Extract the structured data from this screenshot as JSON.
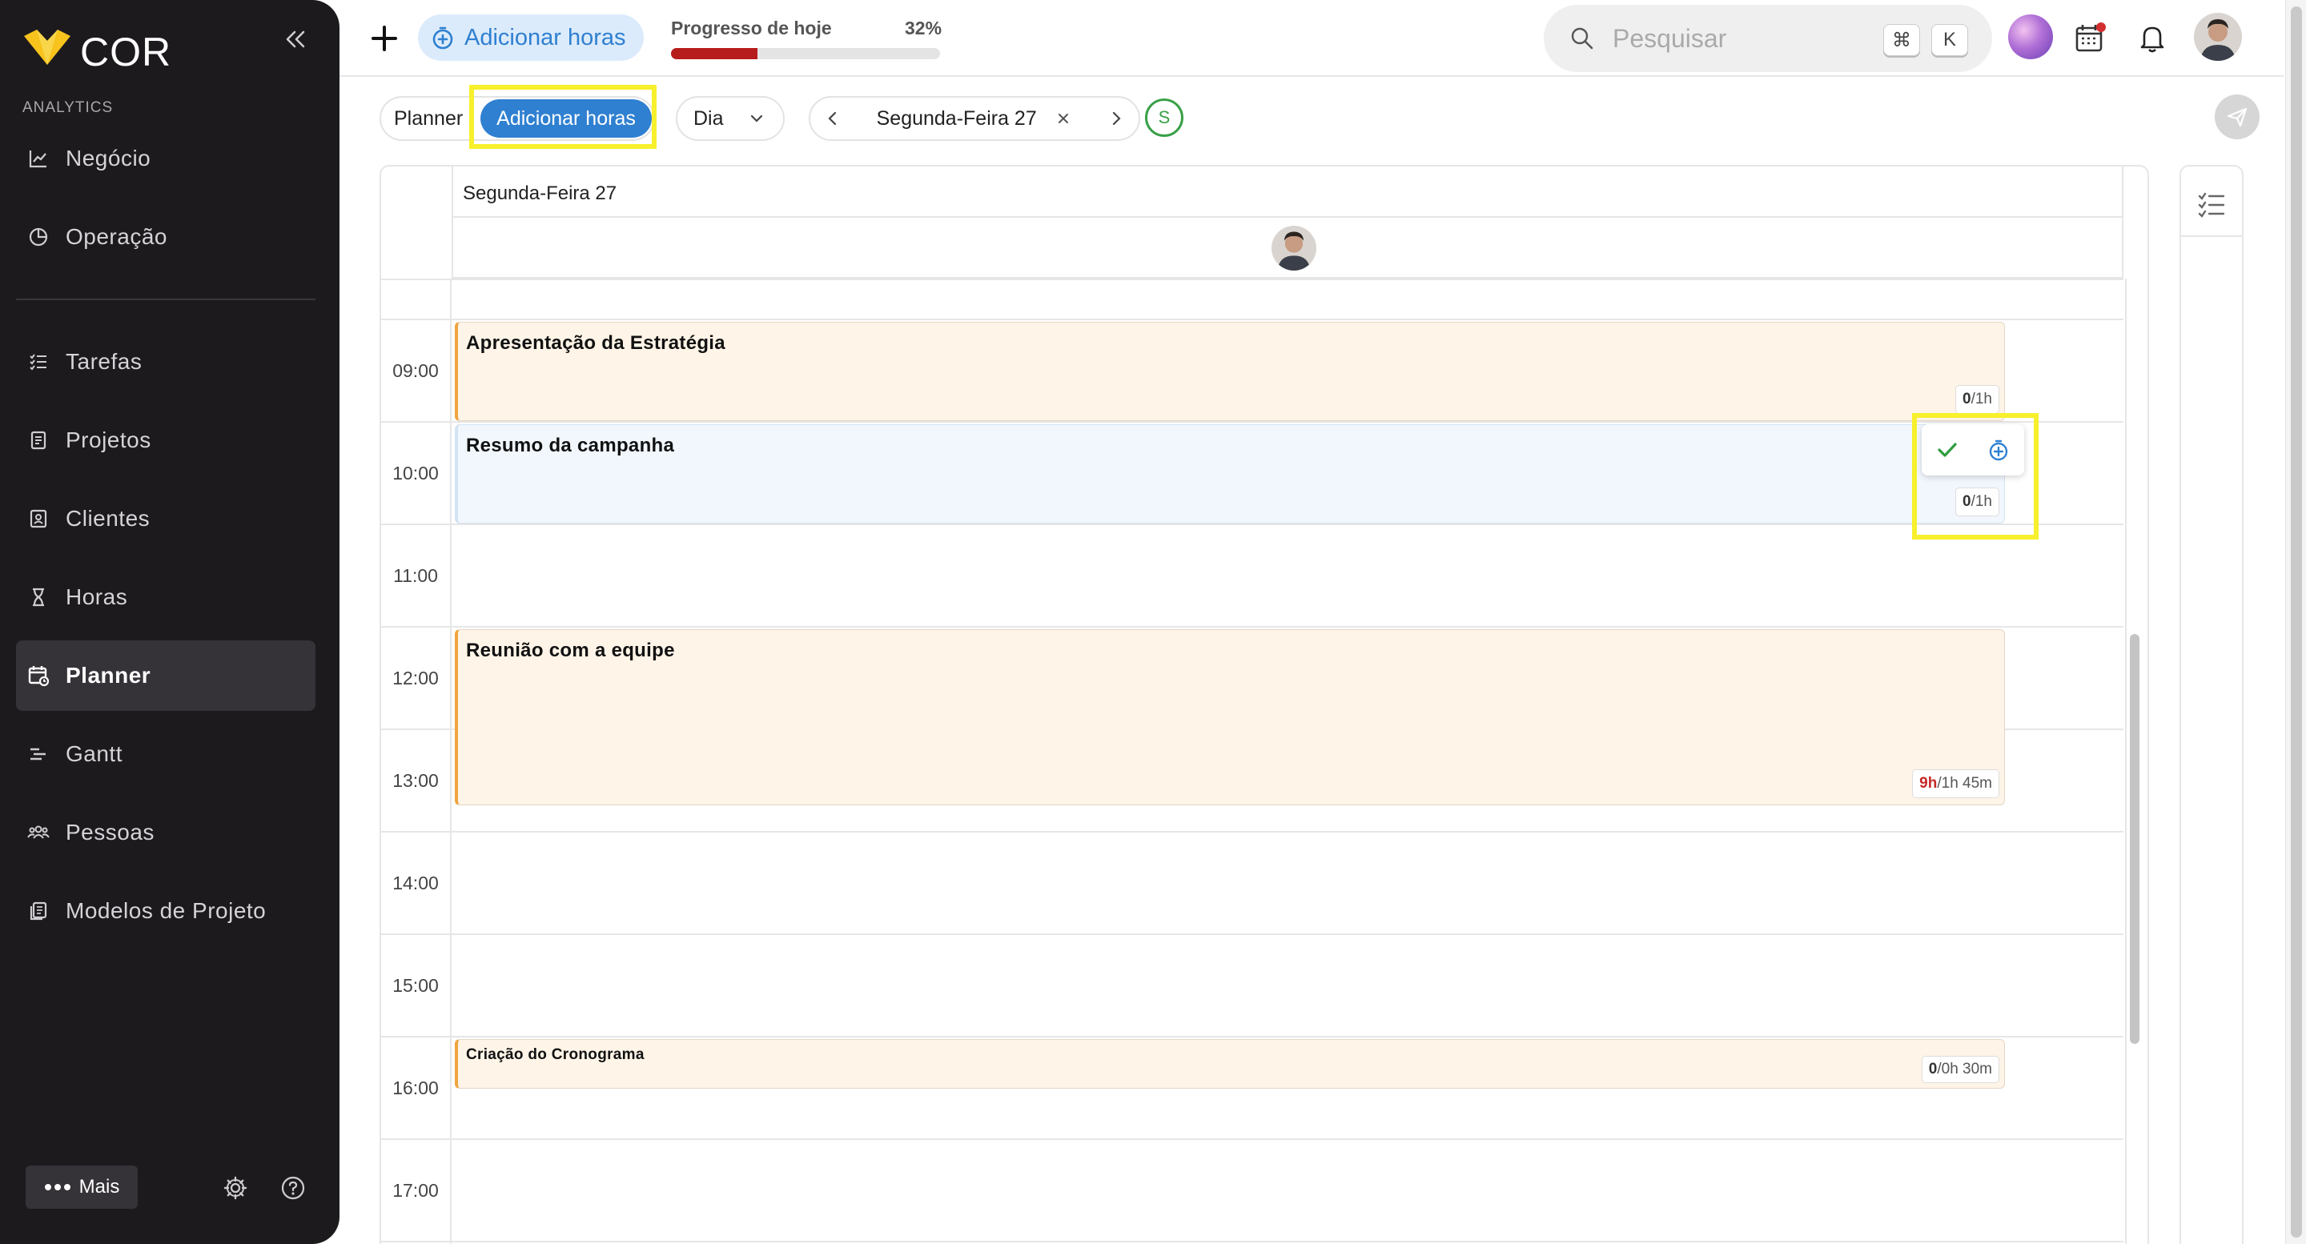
{
  "app": {
    "brand": "COR",
    "section_label": "ANALYTICS"
  },
  "sidebar": {
    "items": [
      {
        "label": "Negócio",
        "icon": "chart-line-icon"
      },
      {
        "label": "Operação",
        "icon": "pie-chart-icon"
      },
      {
        "label": "Tarefas",
        "icon": "task-list-icon"
      },
      {
        "label": "Projetos",
        "icon": "document-icon"
      },
      {
        "label": "Clientes",
        "icon": "contacts-icon"
      },
      {
        "label": "Horas",
        "icon": "hourglass-icon"
      },
      {
        "label": "Planner",
        "icon": "calendar-clock-icon",
        "active": true
      },
      {
        "label": "Gantt",
        "icon": "gantt-icon"
      },
      {
        "label": "Pessoas",
        "icon": "people-icon"
      },
      {
        "label": "Modelos de Projeto",
        "icon": "templates-icon"
      }
    ],
    "more_label": "Mais"
  },
  "topbar": {
    "add_hours_label": "Adicionar horas",
    "progress_label": "Progresso de hoje",
    "progress_percent": "32%",
    "progress_value": 0.32,
    "search_placeholder": "Pesquisar",
    "shortcut_key_1": "⌘",
    "shortcut_key_2": "K"
  },
  "toolbar": {
    "view_planner": "Planner",
    "view_add_hours": "Adicionar horas",
    "period_select": "Dia",
    "date_label": "Segunda-Feira 27",
    "status_letter": "S"
  },
  "calendar": {
    "day_header": "Segunda-Feira 27",
    "hours": [
      "09:00",
      "10:00",
      "11:00",
      "12:00",
      "13:00",
      "14:00",
      "15:00",
      "16:00",
      "17:00"
    ],
    "events": [
      {
        "title": "Apresentação da Estratégia",
        "logged": "0",
        "planned": "/1h",
        "color": "orange"
      },
      {
        "title": "Resumo da campanha",
        "logged": "0",
        "planned": "/1h",
        "color": "blue"
      },
      {
        "title": "Reunião com a equipe",
        "logged": "9h",
        "planned": "/1h 45m",
        "color": "orange"
      },
      {
        "title": "Criação do Cronograma",
        "logged": "0",
        "planned": "/0h 30m",
        "color": "orange"
      }
    ]
  },
  "colors": {
    "accent": "#2f80d1",
    "sidebar_bg": "#1d1a1e",
    "progress": "#b71c1c",
    "event_orange": "#f0a441",
    "event_blue": "#3a88d3",
    "highlight": "#f7f02c",
    "status_green": "#39a047"
  }
}
